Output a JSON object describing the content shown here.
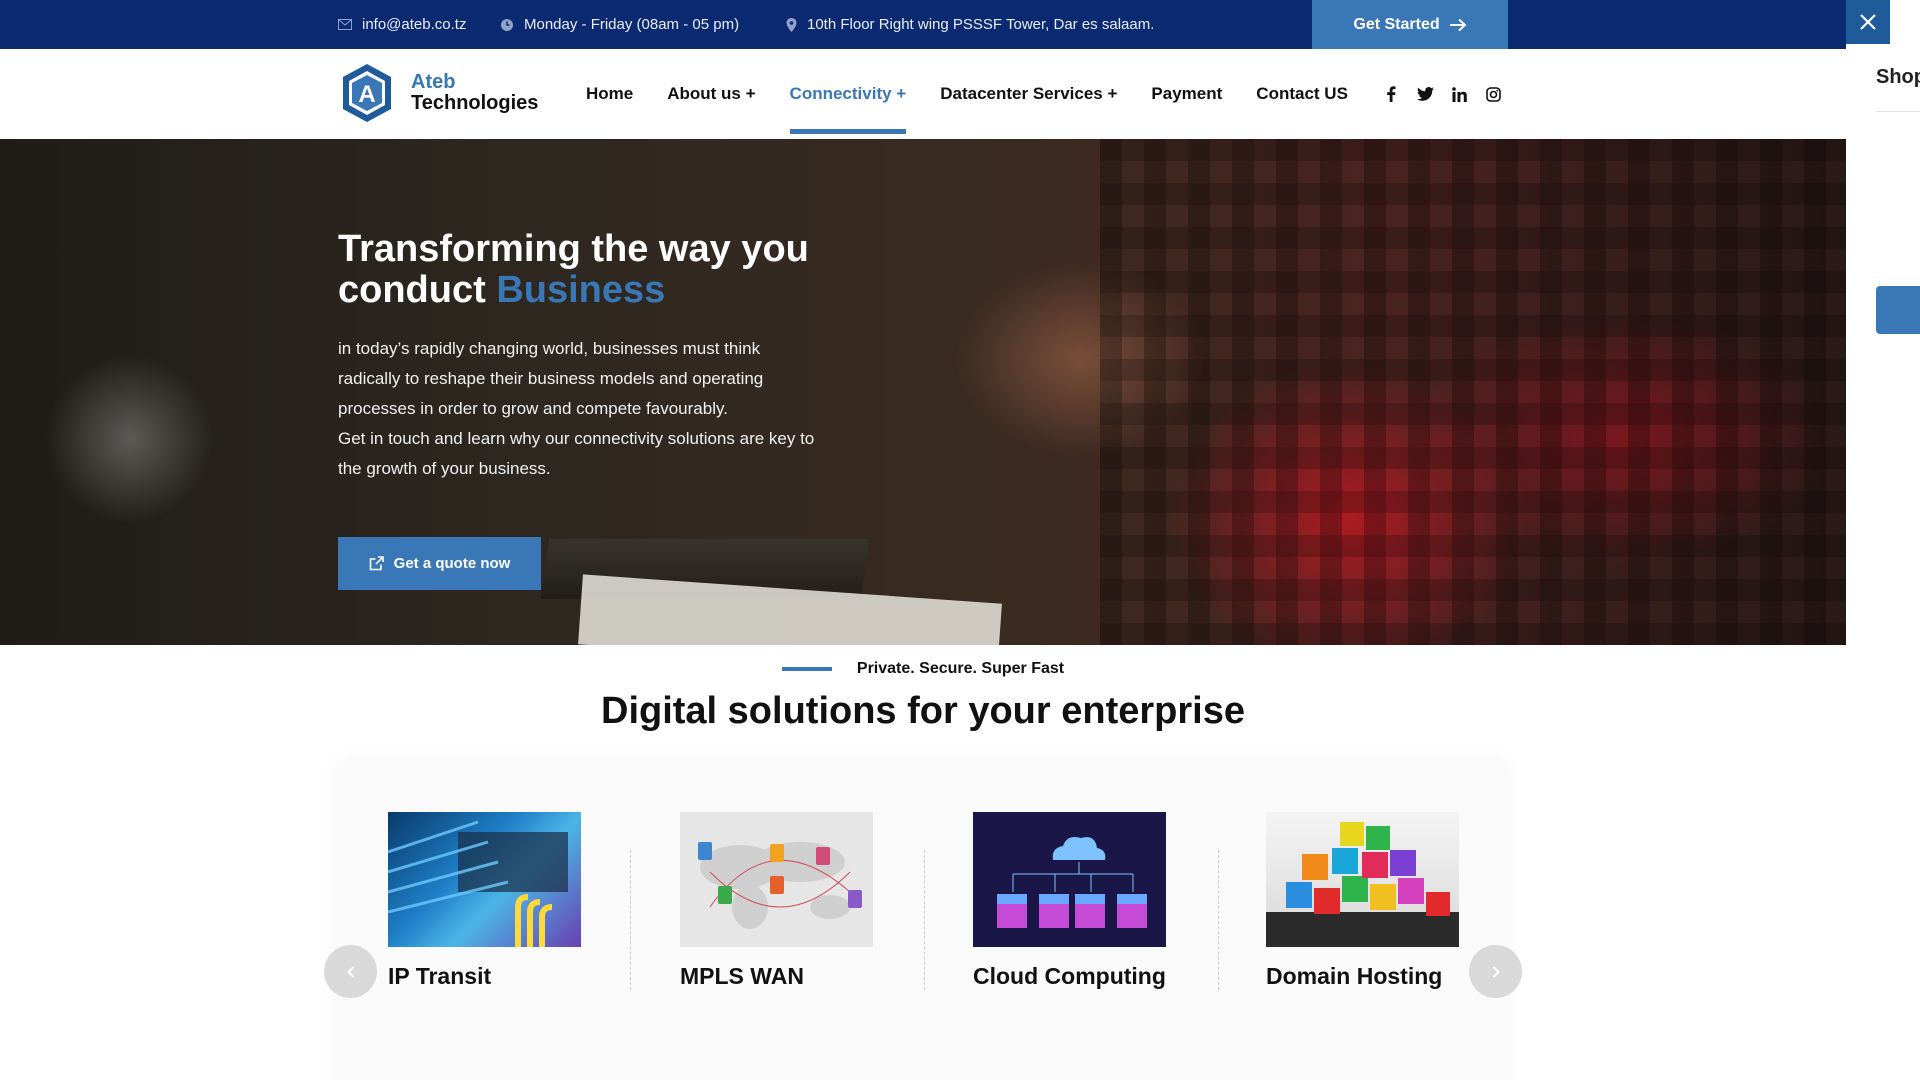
{
  "topbar": {
    "email": "info@ateb.co.tz",
    "hours": "Monday - Friday (08am - 05 pm)",
    "address": "10th Floor Right wing PSSSF Tower, Dar es salaam.",
    "cta_label": "Get Started"
  },
  "logo": {
    "line1": "Ateb",
    "line2": "Technologies",
    "mark": "A"
  },
  "nav": {
    "items": [
      {
        "label": "Home"
      },
      {
        "label": "About us +"
      },
      {
        "label": "Connectivity +"
      },
      {
        "label": "Datacenter Services +"
      },
      {
        "label": "Payment"
      },
      {
        "label": "Contact US"
      }
    ],
    "active": "Connectivity +",
    "socials": [
      "facebook-icon",
      "twitter-icon",
      "linkedin-icon",
      "instagram-icon"
    ]
  },
  "hero": {
    "title_part1": "Transforming the way you conduct ",
    "title_accent": "Business",
    "paragraph1": "in today’s rapidly changing world, businesses must think radically to reshape their business models and operating processes in order to grow and compete favourably.",
    "paragraph2": "Get in touch and learn why our connectivity solutions are key to the growth of your business.",
    "cta_label": "Get a quote now"
  },
  "section": {
    "tagline": "Private. Secure. Super Fast",
    "title": "Digital solutions for your enterprise",
    "cards": [
      {
        "title": "IP Transit"
      },
      {
        "title": "MPLS WAN"
      },
      {
        "title": "Cloud Computing"
      },
      {
        "title": "Domain Hosting"
      }
    ]
  },
  "side_panel": {
    "title": "Shop"
  },
  "colors": {
    "topbar": "#0b2a72",
    "accent": "#3a77b6",
    "close": "#1f5a9a"
  }
}
